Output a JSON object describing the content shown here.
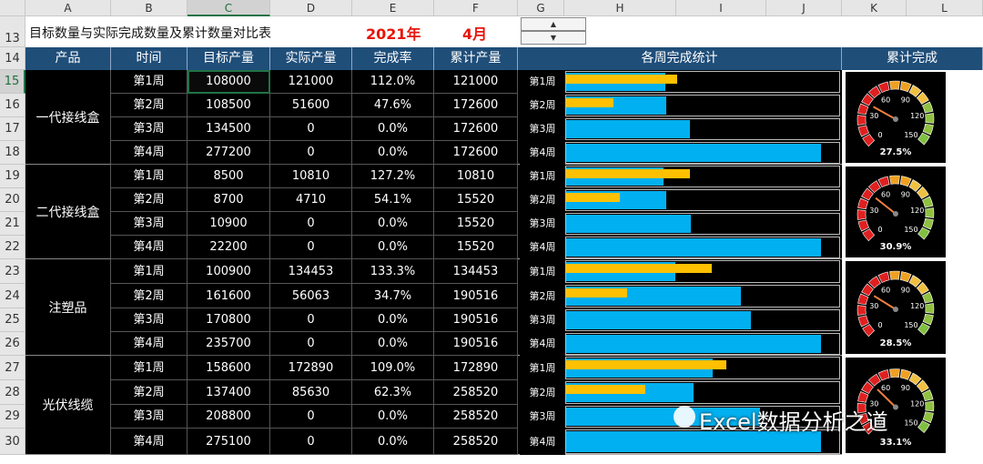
{
  "columns": [
    "A",
    "B",
    "C",
    "D",
    "E",
    "F",
    "G",
    "H",
    "I",
    "J",
    "K",
    "L"
  ],
  "rows": [
    "13",
    "14",
    "15",
    "16",
    "17",
    "18",
    "19",
    "20",
    "21",
    "22",
    "23",
    "24",
    "25",
    "26",
    "27",
    "28",
    "29",
    "30"
  ],
  "title": "目标数量与实际完成数量及累计数量对比表",
  "year": "2021年",
  "month": "4月",
  "spinner": {
    "up": "▲",
    "down": "▼"
  },
  "headers": {
    "product": "产品",
    "time": "时间",
    "target": "目标产量",
    "actual": "实际产量",
    "rate": "完成率",
    "cumulative": "累计产量",
    "weekly": "各周完成统计",
    "cum_done": "累计完成"
  },
  "groups": [
    {
      "name": "一代接线盒",
      "gauge": "27.5%",
      "weeks": [
        {
          "week": "第1周",
          "target": "108000",
          "actual": "121000",
          "rate": "112.0%",
          "cum": "121000"
        },
        {
          "week": "第2周",
          "target": "108500",
          "actual": "51600",
          "rate": "47.6%",
          "cum": "172600"
        },
        {
          "week": "第3周",
          "target": "134500",
          "actual": "0",
          "rate": "0.0%",
          "cum": "172600"
        },
        {
          "week": "第4周",
          "target": "277200",
          "actual": "0",
          "rate": "0.0%",
          "cum": "172600"
        }
      ]
    },
    {
      "name": "二代接线盒",
      "gauge": "30.9%",
      "weeks": [
        {
          "week": "第1周",
          "target": "8500",
          "actual": "10810",
          "rate": "127.2%",
          "cum": "10810"
        },
        {
          "week": "第2周",
          "target": "8700",
          "actual": "4710",
          "rate": "54.1%",
          "cum": "15520"
        },
        {
          "week": "第3周",
          "target": "10900",
          "actual": "0",
          "rate": "0.0%",
          "cum": "15520"
        },
        {
          "week": "第4周",
          "target": "22200",
          "actual": "0",
          "rate": "0.0%",
          "cum": "15520"
        }
      ]
    },
    {
      "name": "注塑品",
      "gauge": "28.5%",
      "weeks": [
        {
          "week": "第1周",
          "target": "100900",
          "actual": "134453",
          "rate": "133.3%",
          "cum": "134453"
        },
        {
          "week": "第2周",
          "target": "161600",
          "actual": "56063",
          "rate": "34.7%",
          "cum": "190516"
        },
        {
          "week": "第3周",
          "target": "170800",
          "actual": "0",
          "rate": "0.0%",
          "cum": "190516"
        },
        {
          "week": "第4周",
          "target": "235700",
          "actual": "0",
          "rate": "0.0%",
          "cum": "190516"
        }
      ]
    },
    {
      "name": "光伏线缆",
      "gauge": "33.1%",
      "weeks": [
        {
          "week": "第1周",
          "target": "158600",
          "actual": "172890",
          "rate": "109.0%",
          "cum": "172890"
        },
        {
          "week": "第2周",
          "target": "137400",
          "actual": "85630",
          "rate": "62.3%",
          "cum": "258520"
        },
        {
          "week": "第3周",
          "target": "208800",
          "actual": "0",
          "rate": "0.0%",
          "cum": "258520"
        },
        {
          "week": "第4周",
          "target": "275100",
          "actual": "0",
          "rate": "0.0%",
          "cum": "258520"
        }
      ]
    }
  ],
  "gauge_ticks": [
    "0",
    "30",
    "60",
    "90",
    "120",
    "150"
  ],
  "watermark": "Excel数据分析之道",
  "colors": {
    "header": "#1f4e79",
    "target_bar": "#00b0f0",
    "actual_bar": "#ffc000",
    "year": "#e8140c"
  }
}
